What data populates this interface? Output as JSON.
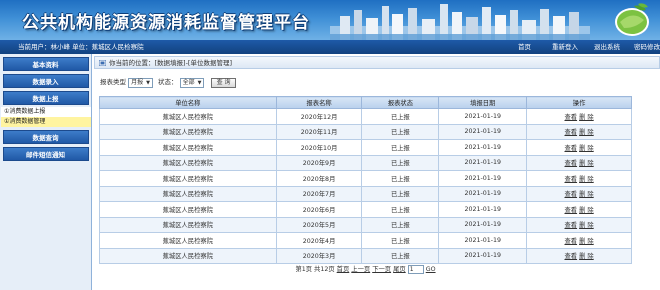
{
  "header": {
    "title": "公共机构能源资源消耗监督管理平台"
  },
  "infobar": {
    "user_info": "当前用户：林小峰  单位：蕉城区人民检察院",
    "nav": [
      "首页",
      "重新登入",
      "退出系统",
      "密码修改"
    ]
  },
  "sidebar": {
    "sections": [
      {
        "label": "基本资料"
      },
      {
        "label": "数据录入"
      },
      {
        "label": "数据上报",
        "items": [
          "①消费数据上报",
          "①消费数据管理"
        ]
      },
      {
        "label": "数据查询"
      },
      {
        "label": "邮件短信通知"
      }
    ],
    "active_item": "①消费数据管理"
  },
  "breadcrumb": {
    "text": "你当前的位置：[数据填报]-[单位数据管理]"
  },
  "filter": {
    "report_type_label": "报表类型",
    "report_type_value": "月报",
    "status_label": "状态：",
    "status_value": "全部",
    "query_button": "查 询"
  },
  "table": {
    "columns": [
      "单位名称",
      "报表名称",
      "报表状态",
      "填报日期",
      "操作"
    ],
    "rows": [
      {
        "unit": "蕉城区人民检察院",
        "report": "2020年12月",
        "status": "已上报",
        "date": "2021-01-19"
      },
      {
        "unit": "蕉城区人民检察院",
        "report": "2020年11月",
        "status": "已上报",
        "date": "2021-01-19"
      },
      {
        "unit": "蕉城区人民检察院",
        "report": "2020年10月",
        "status": "已上报",
        "date": "2021-01-19"
      },
      {
        "unit": "蕉城区人民检察院",
        "report": "2020年9月",
        "status": "已上报",
        "date": "2021-01-19"
      },
      {
        "unit": "蕉城区人民检察院",
        "report": "2020年8月",
        "status": "已上报",
        "date": "2021-01-19"
      },
      {
        "unit": "蕉城区人民检察院",
        "report": "2020年7月",
        "status": "已上报",
        "date": "2021-01-19"
      },
      {
        "unit": "蕉城区人民检察院",
        "report": "2020年6月",
        "status": "已上报",
        "date": "2021-01-19"
      },
      {
        "unit": "蕉城区人民检察院",
        "report": "2020年5月",
        "status": "已上报",
        "date": "2021-01-19"
      },
      {
        "unit": "蕉城区人民检察院",
        "report": "2020年4月",
        "status": "已上报",
        "date": "2021-01-19"
      },
      {
        "unit": "蕉城区人民检察院",
        "report": "2020年3月",
        "status": "已上报",
        "date": "2021-01-19"
      }
    ],
    "actions": [
      "查看",
      "删 除"
    ]
  },
  "pager": {
    "summary": "第1页 共12页",
    "first": "首页",
    "prev": "上一页",
    "next": "下一页",
    "last": "尾页",
    "page_value": "1",
    "go": "GO"
  },
  "colors": {
    "banner": "#1f6fc2",
    "infobar": "#12427f",
    "menu_head": "#2058a6",
    "active_item": "#fff4a0",
    "table_header": "#b9d0ec"
  }
}
